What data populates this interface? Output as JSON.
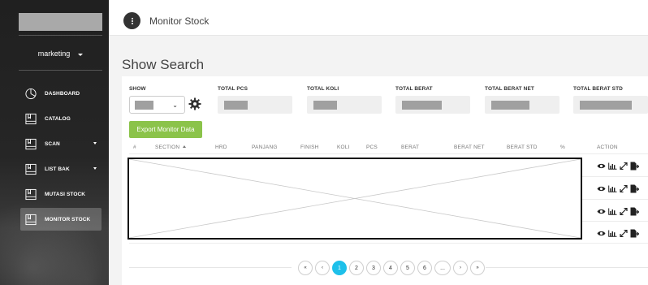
{
  "sidebar": {
    "user_name": "marketing",
    "items": [
      {
        "label": "DASHBOARD",
        "icon": "dashboard-icon"
      },
      {
        "label": "CATALOG",
        "icon": "catalog-icon"
      },
      {
        "label": "SCAN",
        "icon": "scan-icon",
        "has_submenu": true
      },
      {
        "label": "LIST BAK",
        "icon": "list-bak-icon",
        "has_submenu": true
      },
      {
        "label": "MUTASI STOCK",
        "icon": "mutasi-stock-icon"
      },
      {
        "label": "MONITOR STOCK",
        "icon": "monitor-stock-icon",
        "active": true
      }
    ]
  },
  "topbar": {
    "title": "Monitor Stock"
  },
  "page": {
    "heading": "Show Search"
  },
  "filters": {
    "show_label": "SHOW",
    "total_pcs_label": "TOTAL PCS",
    "total_koli_label": "TOTAL KOLI",
    "total_berat_label": "TOTAL BERAT",
    "total_berat_net_label": "TOTAL BERAT NET",
    "total_berat_std_label": "TOTAL BERAT STD"
  },
  "export_button_label": "Export Monitor Data",
  "table": {
    "columns": [
      "#",
      "SECTION",
      "HRD",
      "PANJANG",
      "FINISH",
      "KOLI",
      "PCS",
      "BERAT",
      "BERAT NET",
      "BERAT STD",
      "%",
      "ACTION"
    ],
    "sorted_column": "SECTION",
    "row_actions": [
      "view-icon",
      "chart-icon",
      "transfer-icon",
      "export-file-icon"
    ]
  },
  "pagination": {
    "first": "«",
    "prev": "‹",
    "pages": [
      "1",
      "2",
      "3",
      "4",
      "5",
      "6"
    ],
    "ellipsis": "...",
    "next": "›",
    "last": "»",
    "current": "1"
  },
  "colors": {
    "accent_green": "#8bc34a",
    "pagination_active": "#1ec0ea",
    "sidebar_bg": "#222222"
  }
}
